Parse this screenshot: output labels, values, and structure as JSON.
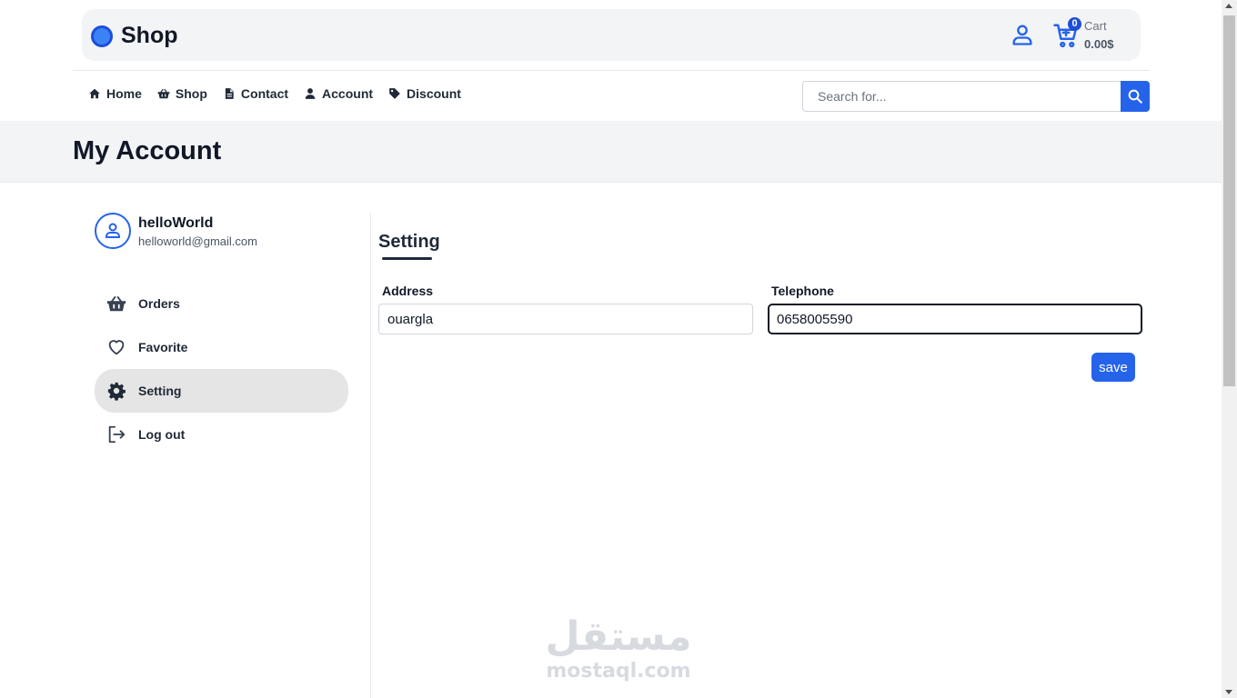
{
  "brand": {
    "name": "Shop",
    "accent": "#2563eb"
  },
  "cart": {
    "count": "0",
    "label": "Cart",
    "total": "0.00$"
  },
  "nav": {
    "items": [
      {
        "label": "Home",
        "icon": "home-icon"
      },
      {
        "label": "Shop",
        "icon": "basket-icon"
      },
      {
        "label": "Contact",
        "icon": "document-icon"
      },
      {
        "label": "Account",
        "icon": "user-icon"
      },
      {
        "label": "Discount",
        "icon": "tag-icon"
      }
    ]
  },
  "search": {
    "placeholder": "Search for...",
    "value": ""
  },
  "page": {
    "title": "My Account"
  },
  "profile": {
    "name": "helloWorld",
    "email": "helloworld@gmail.com"
  },
  "menu": {
    "items": [
      {
        "label": "Orders",
        "icon": "basket-icon"
      },
      {
        "label": "Favorite",
        "icon": "heart-icon"
      },
      {
        "label": "Setting",
        "icon": "gear-icon",
        "active": true
      },
      {
        "label": "Log out",
        "icon": "logout-icon"
      }
    ]
  },
  "settings": {
    "title": "Setting",
    "address_label": "Address",
    "address_value": "ouargla",
    "telephone_label": "Telephone",
    "telephone_value": "0658005590",
    "save_label": "save"
  },
  "watermark": {
    "arabic": "مستقل",
    "latin": "mostaql.com"
  }
}
